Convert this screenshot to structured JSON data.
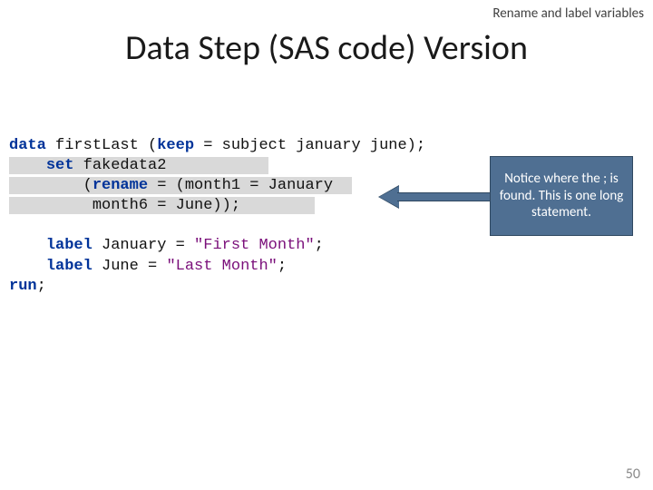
{
  "breadcrumb": "Rename and label variables",
  "title": "Data Step (SAS code) Version",
  "code": {
    "l1a": "data",
    "l1b": " firstLast (",
    "l1c": "keep",
    "l1d": " = subject january june);",
    "l2a": "    ",
    "l2b": "set",
    "l2c": " fakedata2",
    "l3a": "        (",
    "l3b": "rename",
    "l3c": " = (month1 = January",
    "l4a": "         month6 = June));",
    "l5": " ",
    "l6a": "    ",
    "l6b": "label",
    "l6c": " January = ",
    "l6d": "\"First Month\"",
    "l6e": ";",
    "l7a": "    ",
    "l7b": "label",
    "l7c": " June = ",
    "l7d": "\"Last Month\"",
    "l7e": ";",
    "l8a": "run",
    "l8b": ";"
  },
  "callout": "Notice where the ; is found.  This is one long statement.",
  "page_number": "50"
}
